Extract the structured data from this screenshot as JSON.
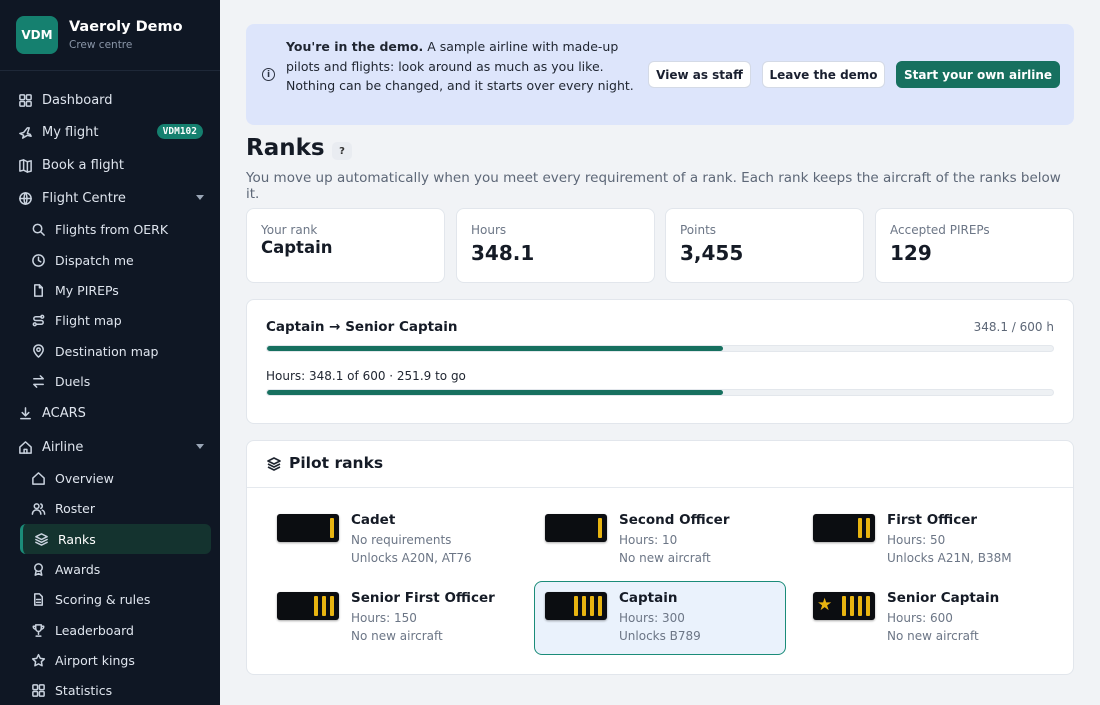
{
  "brand": {
    "logo": "VDM",
    "name": "Vaeroly Demo",
    "subtitle": "Crew centre"
  },
  "sidebar": {
    "dashboard": "Dashboard",
    "my_flight": "My flight",
    "my_flight_badge": "VDM102",
    "book_flight": "Book a flight",
    "flight_centre": "Flight Centre",
    "flights_from": "Flights from OERK",
    "dispatch": "Dispatch me",
    "my_pireps": "My PIREPs",
    "flight_map": "Flight map",
    "destination_map": "Destination map",
    "duels": "Duels",
    "acars": "ACARS",
    "airline": "Airline",
    "overview": "Overview",
    "roster": "Roster",
    "ranks": "Ranks",
    "awards": "Awards",
    "scoring": "Scoring & rules",
    "leaderboard": "Leaderboard",
    "airport_kings": "Airport kings",
    "statistics": "Statistics"
  },
  "banner": {
    "bold": "You're in the demo.",
    "text": " A sample airline with made-up pilots and flights: look around as much as you like. Nothing can be changed, and it starts over every night.",
    "view_as_staff": "View as staff",
    "leave_demo": "Leave the demo",
    "start_airline": "Start your own airline"
  },
  "page": {
    "title": "Ranks",
    "help": "?",
    "subtitle": "You move up automatically when you meet every requirement of a rank. Each rank keeps the aircraft of the ranks below it."
  },
  "stats": {
    "rank_label": "Your rank",
    "rank_value": "Captain",
    "hours_label": "Hours",
    "hours_value": "348.1",
    "points_label": "Points",
    "points_value": "3,455",
    "pireps_label": "Accepted PIREPs",
    "pireps_value": "129"
  },
  "progress": {
    "title": "Captain → Senior Captain",
    "summary": "348.1 / 600 h",
    "overall_fraction": 0.58,
    "detail": "Hours: 348.1 of 600 · 251.9 to go",
    "hours_fraction": 0.58
  },
  "ranks_card": {
    "title": "Pilot ranks",
    "ranks": [
      {
        "name": "Cadet",
        "line1": "No requirements",
        "line2": "Unlocks A20N, AT76",
        "stripes": 1,
        "star": false,
        "current": false
      },
      {
        "name": "Second Officer",
        "line1": "Hours: 10",
        "line2": "No new aircraft",
        "stripes": 1,
        "star": false,
        "current": false
      },
      {
        "name": "First Officer",
        "line1": "Hours: 50",
        "line2": "Unlocks A21N, B38M",
        "stripes": 2,
        "star": false,
        "current": false
      },
      {
        "name": "Senior First Officer",
        "line1": "Hours: 150",
        "line2": "No new aircraft",
        "stripes": 3,
        "star": false,
        "current": false
      },
      {
        "name": "Captain",
        "line1": "Hours: 300",
        "line2": "Unlocks B789",
        "stripes": 4,
        "star": false,
        "current": true
      },
      {
        "name": "Senior Captain",
        "line1": "Hours: 600",
        "line2": "No new aircraft",
        "stripes": 4,
        "star": true,
        "current": false
      }
    ]
  },
  "colors": {
    "accent": "#17705f",
    "sidebar_bg": "#0f1724",
    "banner_bg": "#dde5fb",
    "stripe": "#e8b410"
  }
}
